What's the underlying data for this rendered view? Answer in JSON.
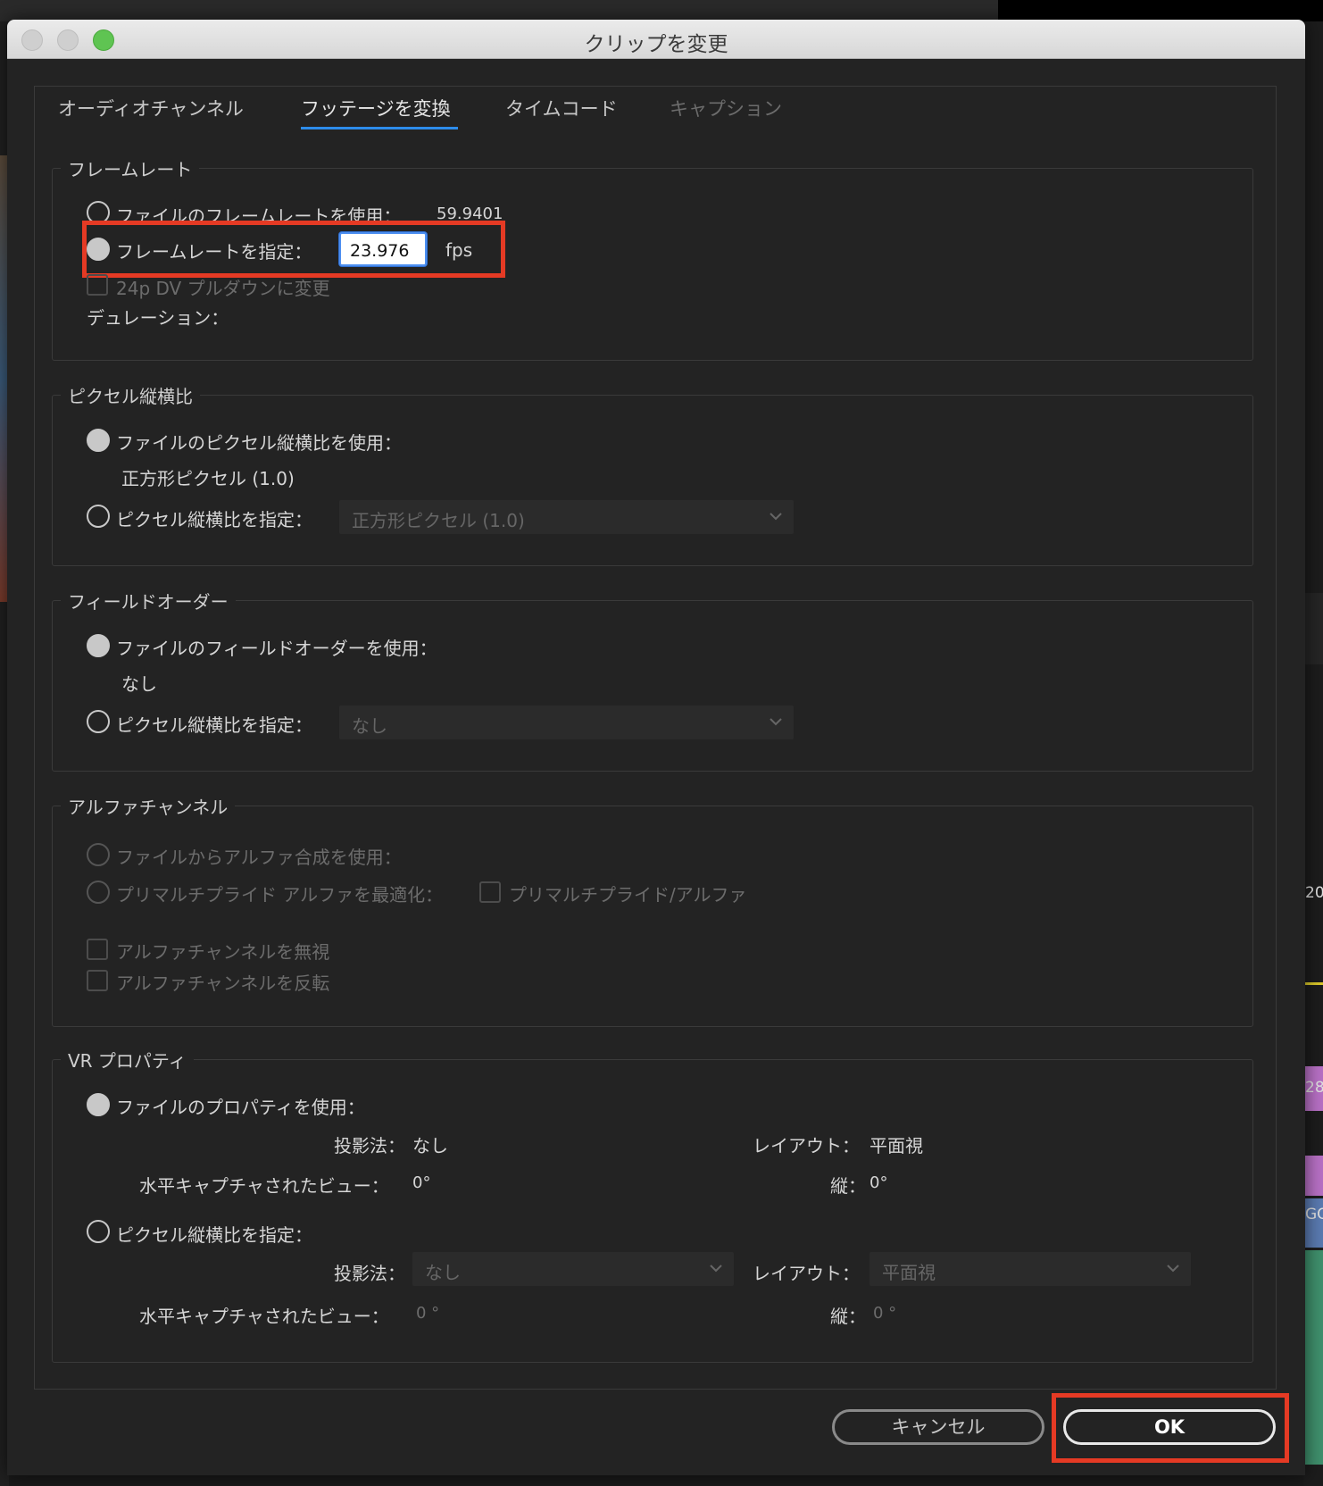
{
  "window": {
    "title": "クリップを変更"
  },
  "tabs": [
    {
      "label": "オーディオチャンネル"
    },
    {
      "label": "フッテージを変換"
    },
    {
      "label": "タイムコード"
    },
    {
      "label": "キャプション"
    }
  ],
  "frame_rate": {
    "title": "フレームレート",
    "use_file_label": "ファイルのフレームレートを使用：",
    "use_file_value": "59.9401",
    "assume_label": "フレームレートを指定：",
    "assume_value": "23.976",
    "unit": "fps",
    "pulldown_label": "24p DV プルダウンに変更",
    "duration_label": "デュレーション："
  },
  "pixel_aspect": {
    "title": "ピクセル縦横比",
    "use_file_label": "ファイルのピクセル縦横比を使用：",
    "use_file_value": "正方形ピクセル (1.0)",
    "conform_label": "ピクセル縦横比を指定：",
    "conform_select": "正方形ピクセル (1.0)"
  },
  "field_order": {
    "title": "フィールドオーダー",
    "use_file_label": "ファイルのフィールドオーダーを使用：",
    "use_file_value": "なし",
    "conform_label": "ピクセル縦横比を指定：",
    "conform_select": "なし"
  },
  "alpha": {
    "title": "アルファチャンネル",
    "use_file_label": "ファイルからアルファ合成を使用：",
    "premult_label": "プリマルチプライド アルファを最適化：",
    "premult_check_label": "プリマルチプライド/アルファ",
    "ignore_label": "アルファチャンネルを無視",
    "invert_label": "アルファチャンネルを反転"
  },
  "vr": {
    "title": "VR プロパティ",
    "use_file_label": "ファイルのプロパティを使用：",
    "projection_label": "投影法：",
    "projection_value": "なし",
    "layout_label": "レイアウト：",
    "layout_value": "平面視",
    "hview_label": "水平キャプチャされたビュー：",
    "hview_value": "0°",
    "vview_label": "縦：",
    "vview_value": "0°",
    "conform_label": "ピクセル縦横比を指定：",
    "conform_projection_select": "なし",
    "conform_layout_select": "平面視",
    "conform_hview_value": "0 °",
    "conform_vview_value": "0 °"
  },
  "buttons": {
    "cancel": "キャンセル",
    "ok": "OK"
  },
  "background": {
    "right_text_1": "20",
    "right_text_2": "28",
    "right_text_3": "GO"
  },
  "colors": {
    "accent": "#2d8ceb",
    "highlight": "#e53a24"
  }
}
